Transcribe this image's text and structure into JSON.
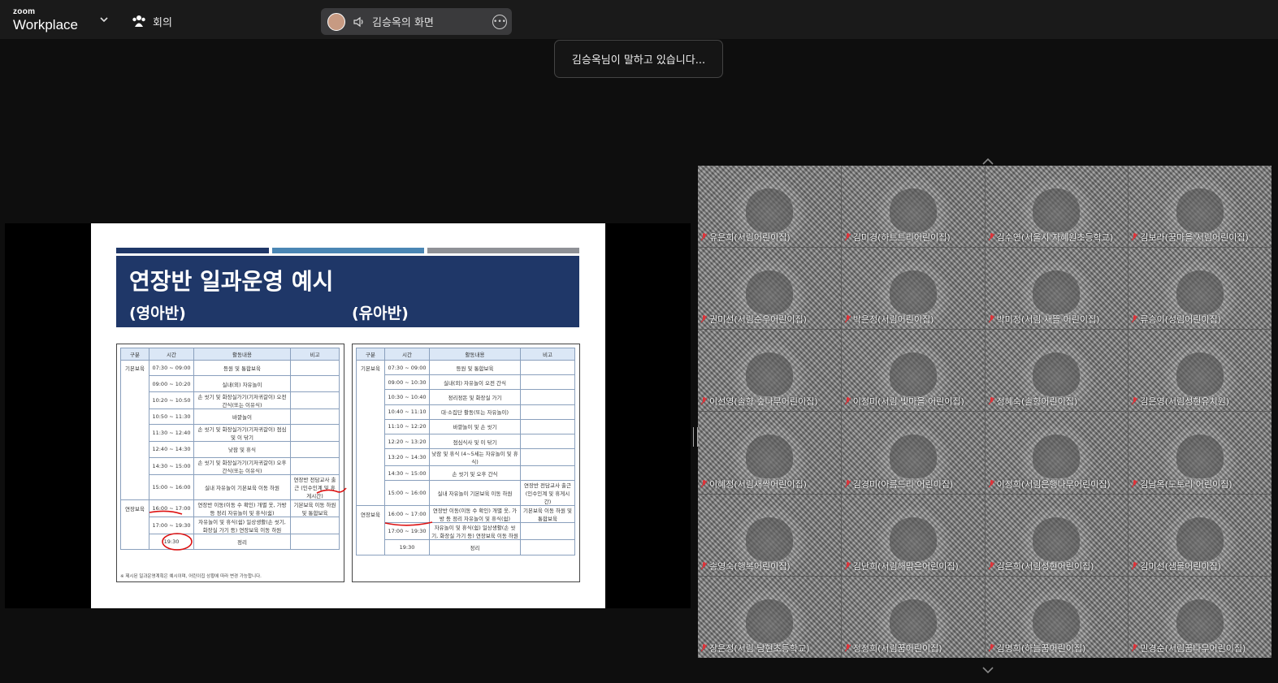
{
  "topbar": {
    "logo_small": "zoom",
    "logo_main": "Workplace",
    "meeting_label": "회의",
    "share_label": "김승옥의 화면"
  },
  "speaking_banner": "김승옥님이 말하고 있습니다...",
  "slide": {
    "title": "연장반 일과운영 예시",
    "left_caption": "(영아반)",
    "right_caption": "(유아반)",
    "headers": [
      "구분",
      "시간",
      "활동내용",
      "비고"
    ],
    "infant_rows": [
      [
        "기본보육",
        "07:30 ~ 09:00",
        "등원 및 통합보육",
        ""
      ],
      [
        "",
        "09:00 ~ 10:20",
        "실내(외) 자유놀이",
        ""
      ],
      [
        "",
        "10:20 ~ 10:50",
        "손 씻기 및 화장실가기(기저귀갈이) 오전 간식(또는 이유식)",
        ""
      ],
      [
        "",
        "10:50 ~ 11:30",
        "바깥놀이",
        ""
      ],
      [
        "",
        "11:30 ~ 12:40",
        "손 씻기 및 화장실가기(기저귀갈이) 점심 및 이 닦기",
        ""
      ],
      [
        "",
        "12:40 ~ 14:30",
        "낮잠 및 휴식",
        ""
      ],
      [
        "",
        "14:30 ~ 15:00",
        "손 씻기 및 화장실가기(기저귀갈이) 오후 간식(또는 이유식)",
        ""
      ],
      [
        "",
        "15:00 ~ 16:00",
        "실내 자유놀이 기본보육 이동 하원",
        "연장반 전담교사 출근 (인수인계 및 휴게시간)"
      ],
      [
        "연장보육",
        "16:00 ~ 17:00",
        "연장반 이동(이동 수 확인) 개별 옷, 가방 등 정리 자유놀이 및 휴식(쉼)",
        "기본보육 이동 하원 및 통합보육"
      ],
      [
        "",
        "17:00 ~ 19:30",
        "자유놀이 및 휴식(쉼) 일상생활(손 씻기, 화장실 가기 등) 연장보육 이동 하원",
        ""
      ],
      [
        "",
        "19:30",
        "정리",
        ""
      ]
    ],
    "child_rows": [
      [
        "기본보육",
        "07:30 ~ 09:00",
        "등원 및 통합보육",
        ""
      ],
      [
        "",
        "09:00 ~ 10:30",
        "실내(외) 자유놀이 오전 간식",
        ""
      ],
      [
        "",
        "10:30 ~ 10:40",
        "정리정돈 및 화장실 가기",
        ""
      ],
      [
        "",
        "10:40 ~ 11:10",
        "대·소집단 활동(또는 자유놀이)",
        ""
      ],
      [
        "",
        "11:10 ~ 12:20",
        "바깥놀이 및 손 씻기",
        ""
      ],
      [
        "",
        "12:20 ~ 13:20",
        "점심식사 및 이 닦기",
        ""
      ],
      [
        "",
        "13:20 ~ 14:30",
        "낮잠 및 휴식 (4~5세는 자유놀이 및 휴식)",
        ""
      ],
      [
        "",
        "14:30 ~ 15:00",
        "손 씻기 및 오후 간식",
        ""
      ],
      [
        "",
        "15:00 ~ 16:00",
        "실내 자유놀이 기본보육 이동 하원",
        "연장반 전담교사 출근 (인수인계 및 휴게시간)"
      ],
      [
        "연장보육",
        "16:00 ~ 17:00",
        "연장반 이동(이동 수 확인) 개별 옷, 가방 등 정리 자유놀이 및 휴식(쉼)",
        "기본보육 이동 하원 및 통합보육"
      ],
      [
        "",
        "17:00 ~ 19:30",
        "자유놀이 및 휴식(쉼) 일상생활(손 씻기, 화장실 가기 등) 연장보육 이동 하원",
        ""
      ],
      [
        "",
        "19:30",
        "정리",
        ""
      ]
    ],
    "footnote": "※ 제시된 일과운영계획은 예시이며, 어린이집 상황에 따라 변경 가능합니다."
  },
  "participants": [
    "유은희(서림어린이집)",
    "김미경(하트트리어린이집)",
    "김수연(서울시 자혜원초등학교)",
    "김보라(꿈마을 서림어린이집)",
    "권미선(서림순우어린이집)",
    "박은정(서림어린이집)",
    "박미정(서림 새뜰 어린이집)",
    "류승이(성림어린이집)",
    "이선영(솔향 숲나무어린이집)",
    "이정미(서림 빛마을 어린이집)",
    "정혜숙(솔향어린이집)",
    "김은영(서림성현유치원)",
    "이혜정(서림새싹어린이집)",
    "김경미(아름드리 어린이집)",
    "이정희(서림은행나무어린이집)",
    "김남옥(도토리 어린이집)",
    "송영숙(행복어린이집)",
    "김난희(서림해맑은어린이집)",
    "김은희(서림성현어린이집)",
    "김미선(샘물어린이집)",
    "장은정(서림 남현초등학교)",
    "정정희(서림꿈어린이집)",
    "김명희(하늘꿈어린이집)",
    "민경순(서림꿈나무어린이집)"
  ],
  "colors": {
    "slide_header": "#1f3768",
    "bar1": "#1f3768",
    "bar2": "#4a86b4",
    "bar3": "#8f9196",
    "muted_mic": "#e0333a"
  }
}
